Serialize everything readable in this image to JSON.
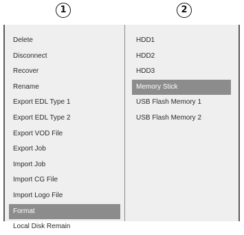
{
  "callouts": {
    "left": "1",
    "right": "2"
  },
  "left_menu": {
    "selected_index": 11,
    "items": [
      {
        "label": "Delete"
      },
      {
        "label": "Disconnect"
      },
      {
        "label": "Recover"
      },
      {
        "label": "Rename"
      },
      {
        "label": "Export EDL Type 1"
      },
      {
        "label": "Export EDL Type 2"
      },
      {
        "label": "Export VOD File"
      },
      {
        "label": "Export Job"
      },
      {
        "label": "Import Job"
      },
      {
        "label": "Import CG File"
      },
      {
        "label": "Import Logo File"
      },
      {
        "label": "Format"
      },
      {
        "label": "Local Disk Remain"
      }
    ]
  },
  "right_menu": {
    "selected_index": 3,
    "items": [
      {
        "label": "HDD1"
      },
      {
        "label": "HDD2"
      },
      {
        "label": "HDD3"
      },
      {
        "label": "Memory Stick"
      },
      {
        "label": "USB Flash Memory 1"
      },
      {
        "label": "USB Flash Memory 2"
      }
    ]
  },
  "colors": {
    "selected_background": "#8c8c8c",
    "panel_background": "#efefef",
    "selected_text": "#ffffff"
  }
}
